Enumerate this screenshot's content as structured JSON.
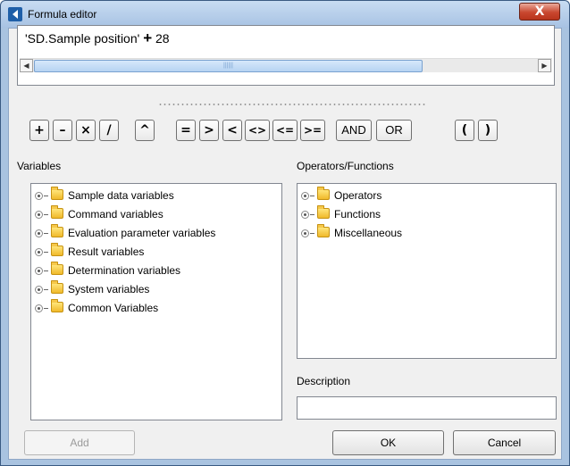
{
  "window": {
    "title": "Formula editor",
    "close_label": "X"
  },
  "formula": {
    "part1": "'SD.Sample position' ",
    "operator": "+",
    "part2": " 28",
    "scroll_left": "◀",
    "scroll_right": "▶",
    "scroll_grip": "||||||"
  },
  "operators": [
    "+",
    "–",
    "×",
    "/",
    "^",
    "=",
    ">",
    "<",
    "<>",
    "<=",
    ">=",
    "AND",
    "OR",
    "(",
    ")"
  ],
  "variables": {
    "label": "Variables",
    "items": [
      "Sample data variables",
      "Command variables",
      "Evaluation parameter variables",
      "Result variables",
      "Determination variables",
      "System variables",
      "Common Variables"
    ]
  },
  "functions": {
    "label": "Operators/Functions",
    "items": [
      "Operators",
      "Functions",
      "Miscellaneous"
    ]
  },
  "description": {
    "label": "Description",
    "value": ""
  },
  "buttons": {
    "add": "Add",
    "ok": "OK",
    "cancel": "Cancel"
  },
  "colors": {
    "title_bar": "#a7c2e3",
    "close_button": "#c9472f",
    "folder": "#f0b92a"
  }
}
